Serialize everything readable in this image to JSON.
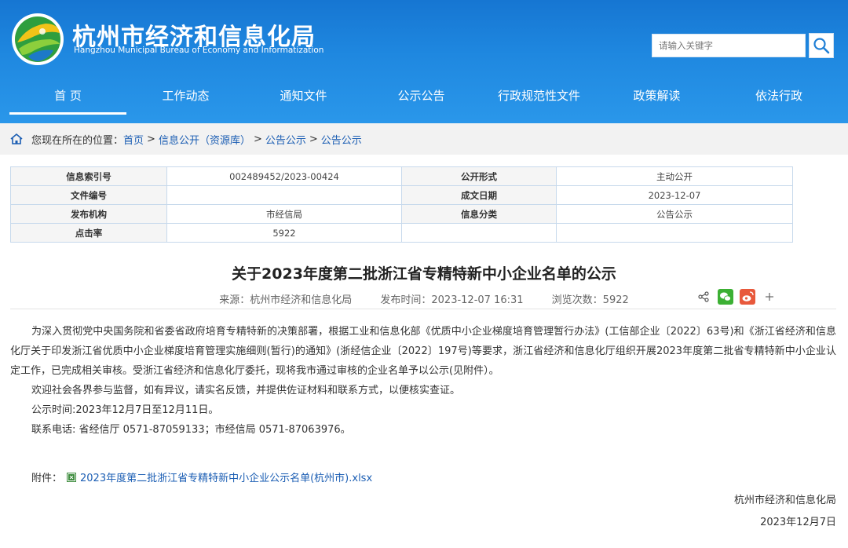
{
  "header": {
    "title_cn": "杭州市经济和信息化局",
    "title_en": "Hangzhou Municipal Bureau of Economy and Informatization",
    "search_placeholder": "请输入关键字"
  },
  "nav": {
    "items": [
      "首 页",
      "工作动态",
      "通知文件",
      "公示公告",
      "行政规范性文件",
      "政策解读",
      "依法行政"
    ],
    "active": 0
  },
  "breadcrumb": {
    "label": "您现在所在的位置：",
    "items": [
      "首页",
      "信息公开（资源库）",
      "公告公示",
      "公告公示"
    ]
  },
  "info": {
    "index_no_label": "信息索引号",
    "index_no": "002489452/2023-00424",
    "open_form_label": "公开形式",
    "open_form": "主动公开",
    "doc_no_label": "文件编号",
    "doc_no": "",
    "date_label": "成文日期",
    "date": "2023-12-07",
    "publisher_label": "发布机构",
    "publisher": "市经信局",
    "category_label": "信息分类",
    "category": "公告公示",
    "clicks_label": "点击率",
    "clicks": "5922"
  },
  "article": {
    "title": "关于2023年度第二批浙江省专精特新中小企业名单的公示",
    "source": "来源：杭州市经济和信息化局",
    "published": "发布时间：2023-12-07 16:31",
    "views": "浏览次数：5922",
    "para1": "为深入贯彻党中央国务院和省委省政府培育专精特新的决策部署，根据工业和信息化部《优质中小企业梯度培育管理暂行办法》(工信部企业〔2022〕63号)和《浙江省经济和信息化厅关于印发浙江省优质中小企业梯度培育管理实施细则(暂行)的通知》(浙经信企业〔2022〕197号)等要求，浙江省经济和信息化厅组织开展2023年度第二批省专精特新中小企业认定工作，已完成相关审核。受浙江省经济和信息化厅委托，现将我市通过审核的企业名单予以公示(见附件）。",
    "para2": "欢迎社会各界参与监督，如有异议，请实名反馈，并提供佐证材料和联系方式，以便核实查证。",
    "para3": "公示时间:2023年12月7日至12月11日。",
    "para4": "联系电话: 省经信厅 0571-87059133；市经信局 0571-87063976。",
    "attachment_label": "附件：",
    "attachment_name": "2023年度第二批浙江省专精特新中小企业公示名单(杭州市).xlsx",
    "signature": "杭州市经济和信息化局",
    "sign_date": "2023年12月7日"
  },
  "colors": {
    "header_blue": "#1f88e0",
    "link": "#1a5db3",
    "wechat": "#3cb034",
    "weibo": "#e8593c"
  },
  "icons": [
    "logo-globe",
    "search-icon",
    "home-icon",
    "share-icon",
    "wechat-icon",
    "weibo-icon",
    "plus-icon",
    "excel-file-icon"
  ]
}
